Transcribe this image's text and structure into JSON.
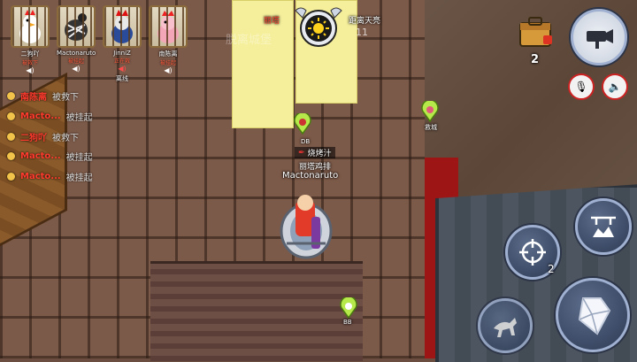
{
  "players": [
    {
      "name": "二狗吖",
      "status": "被救下",
      "speaker": "◀)",
      "extra": ""
    },
    {
      "name": "Mactonaruto",
      "status": "被挂起",
      "speaker": "◀)",
      "extra": ""
    },
    {
      "name": "JinniZ",
      "status": "正在救",
      "speaker": "◀)",
      "extra": "离线"
    },
    {
      "name": "南陈离",
      "status": "被挂起",
      "speaker": "◀)",
      "extra": ""
    }
  ],
  "feed": [
    {
      "name": "南陈离",
      "action": "被救下"
    },
    {
      "name": "Macto...",
      "action": "被挂起"
    },
    {
      "name": "二狗吖",
      "action": "被救下"
    },
    {
      "name": "Macto...",
      "action": "被挂起"
    },
    {
      "name": "Macto...",
      "action": "被挂起"
    }
  ],
  "top_center": {
    "left_label": "丽塔",
    "right_label": "距离天亮",
    "dim_text_left": "脱离城堡",
    "dim_text_right": "11"
  },
  "character": {
    "tag_item": "烧烤汁",
    "tag_sub": "丽塔鸡排",
    "name": "Mactonaruto"
  },
  "map_markers": [
    {
      "label": "DB"
    },
    {
      "label": "救城"
    },
    {
      "label": "BB"
    }
  ],
  "hud": {
    "item_count": "2",
    "skill_count": "2"
  },
  "colors": {
    "name_red": "#ff3b2e",
    "feed_dot": "#f1c34a",
    "red_wall": "#9e1515"
  }
}
